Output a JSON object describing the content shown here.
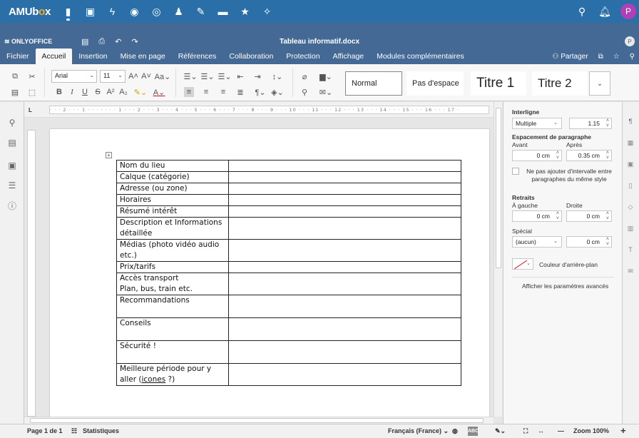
{
  "amubox": {
    "logo_text_a": "AMUb",
    "logo_text_o": "o",
    "logo_text_b": "x",
    "apps": [
      "files-icon",
      "image-icon",
      "activity-icon",
      "dashboard-icon",
      "search-circle-icon",
      "contacts-icon",
      "edit-icon",
      "archive-icon",
      "star-icon",
      "magic-icon"
    ],
    "avatar_letter": "P"
  },
  "oo": {
    "brand": "ONLYOFFICE",
    "doc_title": "Tableau informatif.docx",
    "user_letter": "P"
  },
  "menu": {
    "tabs": [
      "Fichier",
      "Accueil",
      "Insertion",
      "Mise en page",
      "Références",
      "Collaboration",
      "Protection",
      "Affichage",
      "Modules complémentaires"
    ],
    "active": "Accueil",
    "share_label": "Partager"
  },
  "toolbar": {
    "font_name": "Arial",
    "font_size": "11",
    "styles": {
      "normal": "Normal",
      "no_spacing": "Pas d'espace",
      "title1": "Titre 1",
      "title2": "Titre 2"
    }
  },
  "ruler": {
    "h_marks": "· · · 2 · · · 1 · · · · · · · 1 · · · 2 · · · 3 · · · 4 · · · 5 · · · 6 · · · 7 · · · 8 · · · 9 · · · 10 · · · 11 · · · 12 · · · 13 · · · 14 · · · 15 · · · 16 · · · 17 ·"
  },
  "table": {
    "rows": [
      {
        "label": "Nom du lieu"
      },
      {
        "label": "Calque (catégorie)"
      },
      {
        "label": "Adresse (ou zone)"
      },
      {
        "label": "Horaires"
      },
      {
        "label": "Résumé intérêt"
      },
      {
        "label": "Description et Informations détaillée"
      },
      {
        "label": "Médias (photo vidéo audio etc.)"
      },
      {
        "label": "Prix/tarifs"
      },
      {
        "label": "Accès transport",
        "label2": "Plan, bus, train etc."
      },
      {
        "label": "Recommandations"
      },
      {
        "label": "Conseils"
      },
      {
        "label": "Sécurité !"
      },
      {
        "label": "Meilleure période pour y aller (",
        "label_u": "icones",
        "label_end": " ?)"
      }
    ]
  },
  "panel": {
    "interligne_title": "Interligne",
    "interligne_mode": "Multiple",
    "interligne_value": "1.15",
    "spacing_title": "Espacement de paragraphe",
    "before_label": "Avant",
    "after_label": "Après",
    "before_value": "0 cm",
    "after_value": "0.35 cm",
    "no_space_label": "Ne pas ajouter d'intervalle entre paragraphes du même style",
    "indent_title": "Retraits",
    "left_label": "À gauche",
    "right_label": "Droite",
    "left_value": "0 cm",
    "right_value": "0 cm",
    "special_label": "Spécial",
    "special_mode": "(aucun)",
    "special_value": "0 cm",
    "bg_color_label": "Couleur d'arrière-plan",
    "advanced_link": "Afficher les paramètres avancés"
  },
  "status": {
    "page": "Page 1 de 1",
    "stats": "Statistiques",
    "language": "Français (France)",
    "zoom": "Zoom 100%"
  }
}
